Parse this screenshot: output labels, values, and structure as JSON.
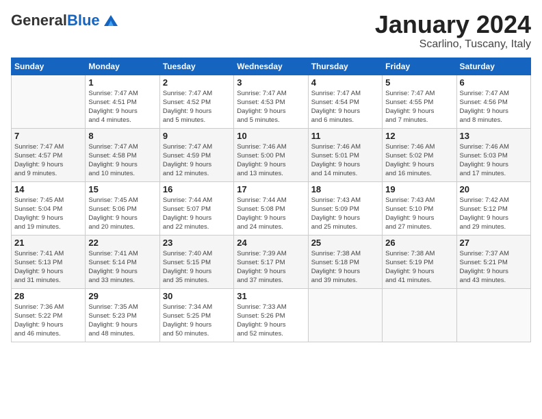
{
  "header": {
    "logo_general": "General",
    "logo_blue": "Blue",
    "title": "January 2024",
    "subtitle": "Scarlino, Tuscany, Italy"
  },
  "weekdays": [
    "Sunday",
    "Monday",
    "Tuesday",
    "Wednesday",
    "Thursday",
    "Friday",
    "Saturday"
  ],
  "weeks": [
    [
      {
        "day": "",
        "empty": true
      },
      {
        "day": "1",
        "sunrise": "Sunrise: 7:47 AM",
        "sunset": "Sunset: 4:51 PM",
        "daylight": "Daylight: 9 hours and 4 minutes."
      },
      {
        "day": "2",
        "sunrise": "Sunrise: 7:47 AM",
        "sunset": "Sunset: 4:52 PM",
        "daylight": "Daylight: 9 hours and 5 minutes."
      },
      {
        "day": "3",
        "sunrise": "Sunrise: 7:47 AM",
        "sunset": "Sunset: 4:53 PM",
        "daylight": "Daylight: 9 hours and 5 minutes."
      },
      {
        "day": "4",
        "sunrise": "Sunrise: 7:47 AM",
        "sunset": "Sunset: 4:54 PM",
        "daylight": "Daylight: 9 hours and 6 minutes."
      },
      {
        "day": "5",
        "sunrise": "Sunrise: 7:47 AM",
        "sunset": "Sunset: 4:55 PM",
        "daylight": "Daylight: 9 hours and 7 minutes."
      },
      {
        "day": "6",
        "sunrise": "Sunrise: 7:47 AM",
        "sunset": "Sunset: 4:56 PM",
        "daylight": "Daylight: 9 hours and 8 minutes."
      }
    ],
    [
      {
        "day": "7",
        "sunrise": "Sunrise: 7:47 AM",
        "sunset": "Sunset: 4:57 PM",
        "daylight": "Daylight: 9 hours and 9 minutes."
      },
      {
        "day": "8",
        "sunrise": "Sunrise: 7:47 AM",
        "sunset": "Sunset: 4:58 PM",
        "daylight": "Daylight: 9 hours and 10 minutes."
      },
      {
        "day": "9",
        "sunrise": "Sunrise: 7:47 AM",
        "sunset": "Sunset: 4:59 PM",
        "daylight": "Daylight: 9 hours and 12 minutes."
      },
      {
        "day": "10",
        "sunrise": "Sunrise: 7:46 AM",
        "sunset": "Sunset: 5:00 PM",
        "daylight": "Daylight: 9 hours and 13 minutes."
      },
      {
        "day": "11",
        "sunrise": "Sunrise: 7:46 AM",
        "sunset": "Sunset: 5:01 PM",
        "daylight": "Daylight: 9 hours and 14 minutes."
      },
      {
        "day": "12",
        "sunrise": "Sunrise: 7:46 AM",
        "sunset": "Sunset: 5:02 PM",
        "daylight": "Daylight: 9 hours and 16 minutes."
      },
      {
        "day": "13",
        "sunrise": "Sunrise: 7:46 AM",
        "sunset": "Sunset: 5:03 PM",
        "daylight": "Daylight: 9 hours and 17 minutes."
      }
    ],
    [
      {
        "day": "14",
        "sunrise": "Sunrise: 7:45 AM",
        "sunset": "Sunset: 5:04 PM",
        "daylight": "Daylight: 9 hours and 19 minutes."
      },
      {
        "day": "15",
        "sunrise": "Sunrise: 7:45 AM",
        "sunset": "Sunset: 5:06 PM",
        "daylight": "Daylight: 9 hours and 20 minutes."
      },
      {
        "day": "16",
        "sunrise": "Sunrise: 7:44 AM",
        "sunset": "Sunset: 5:07 PM",
        "daylight": "Daylight: 9 hours and 22 minutes."
      },
      {
        "day": "17",
        "sunrise": "Sunrise: 7:44 AM",
        "sunset": "Sunset: 5:08 PM",
        "daylight": "Daylight: 9 hours and 24 minutes."
      },
      {
        "day": "18",
        "sunrise": "Sunrise: 7:43 AM",
        "sunset": "Sunset: 5:09 PM",
        "daylight": "Daylight: 9 hours and 25 minutes."
      },
      {
        "day": "19",
        "sunrise": "Sunrise: 7:43 AM",
        "sunset": "Sunset: 5:10 PM",
        "daylight": "Daylight: 9 hours and 27 minutes."
      },
      {
        "day": "20",
        "sunrise": "Sunrise: 7:42 AM",
        "sunset": "Sunset: 5:12 PM",
        "daylight": "Daylight: 9 hours and 29 minutes."
      }
    ],
    [
      {
        "day": "21",
        "sunrise": "Sunrise: 7:41 AM",
        "sunset": "Sunset: 5:13 PM",
        "daylight": "Daylight: 9 hours and 31 minutes."
      },
      {
        "day": "22",
        "sunrise": "Sunrise: 7:41 AM",
        "sunset": "Sunset: 5:14 PM",
        "daylight": "Daylight: 9 hours and 33 minutes."
      },
      {
        "day": "23",
        "sunrise": "Sunrise: 7:40 AM",
        "sunset": "Sunset: 5:15 PM",
        "daylight": "Daylight: 9 hours and 35 minutes."
      },
      {
        "day": "24",
        "sunrise": "Sunrise: 7:39 AM",
        "sunset": "Sunset: 5:17 PM",
        "daylight": "Daylight: 9 hours and 37 minutes."
      },
      {
        "day": "25",
        "sunrise": "Sunrise: 7:38 AM",
        "sunset": "Sunset: 5:18 PM",
        "daylight": "Daylight: 9 hours and 39 minutes."
      },
      {
        "day": "26",
        "sunrise": "Sunrise: 7:38 AM",
        "sunset": "Sunset: 5:19 PM",
        "daylight": "Daylight: 9 hours and 41 minutes."
      },
      {
        "day": "27",
        "sunrise": "Sunrise: 7:37 AM",
        "sunset": "Sunset: 5:21 PM",
        "daylight": "Daylight: 9 hours and 43 minutes."
      }
    ],
    [
      {
        "day": "28",
        "sunrise": "Sunrise: 7:36 AM",
        "sunset": "Sunset: 5:22 PM",
        "daylight": "Daylight: 9 hours and 46 minutes."
      },
      {
        "day": "29",
        "sunrise": "Sunrise: 7:35 AM",
        "sunset": "Sunset: 5:23 PM",
        "daylight": "Daylight: 9 hours and 48 minutes."
      },
      {
        "day": "30",
        "sunrise": "Sunrise: 7:34 AM",
        "sunset": "Sunset: 5:25 PM",
        "daylight": "Daylight: 9 hours and 50 minutes."
      },
      {
        "day": "31",
        "sunrise": "Sunrise: 7:33 AM",
        "sunset": "Sunset: 5:26 PM",
        "daylight": "Daylight: 9 hours and 52 minutes."
      },
      {
        "day": "",
        "empty": true
      },
      {
        "day": "",
        "empty": true
      },
      {
        "day": "",
        "empty": true
      }
    ]
  ]
}
